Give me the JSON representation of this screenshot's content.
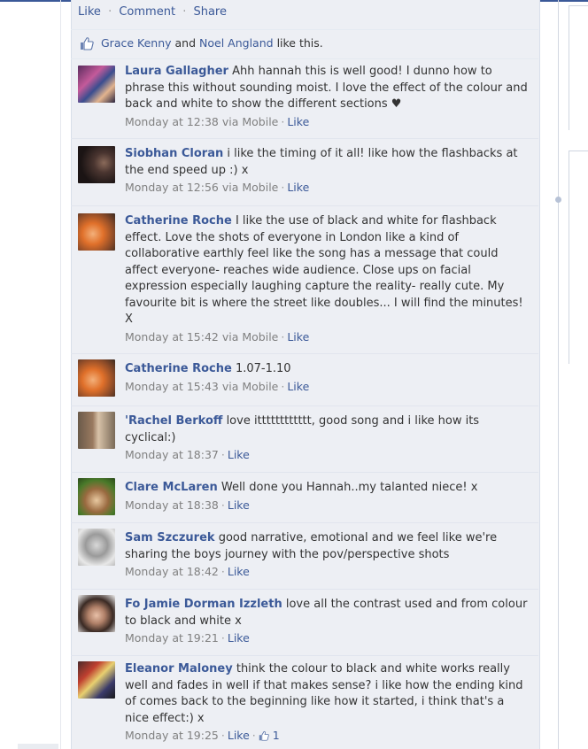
{
  "post_actions": {
    "like": "Like",
    "comment": "Comment",
    "share": "Share",
    "sep": "·"
  },
  "likes": {
    "user1": "Grace Kenny",
    "joiner": "and",
    "user2": "Noel Angland",
    "suffix": "like this."
  },
  "comments": [
    {
      "author": "Laura Gallagher",
      "text": "Ahh hannah this is well good! I dunno how to phrase this without sounding moist. I love the effect of the colour and back and white to show the different sections ♥",
      "time": "Monday at 12:38 via Mobile",
      "like": "Like"
    },
    {
      "author": "Siobhan Cloran",
      "text": "i like the timing of it all! like how the flashbacks at the end speed up :) x",
      "time": "Monday at 12:56 via Mobile",
      "like": "Like"
    },
    {
      "author": "Catherine Roche",
      "text": "I like the use of black and white for flashback effect. Love the shots of everyone in London like a kind of collaborative earthly feel like the song has a message that could affect everyone- reaches wide audience. Close ups on facial expression especially laughing capture the reality- really cute. My favourite bit is where the street like doubles... I will find the minutes! X",
      "time": "Monday at 15:42 via Mobile",
      "like": "Like"
    },
    {
      "author": "Catherine Roche",
      "text": "1.07-1.10",
      "time": "Monday at 15:43 via Mobile",
      "like": "Like"
    },
    {
      "author": "'Rachel Berkoff",
      "text": "love itttttttttttt, good song and i like how its cyclical:)",
      "time": "Monday at 18:37",
      "like": "Like"
    },
    {
      "author": "Clare McLaren",
      "text": "Well done you Hannah..my talanted niece! x",
      "time": "Monday at 18:38",
      "like": "Like"
    },
    {
      "author": "Sam Szczurek",
      "text": "good narrative, emotional and we feel like we're sharing the boys journey with the pov/perspective shots",
      "time": "Monday at 18:42",
      "like": "Like"
    },
    {
      "author": "Fo Jamie Dorman Izzleth",
      "text": "love all the contrast used and from colour to black and white x",
      "time": "Monday at 19:21",
      "like": "Like"
    },
    {
      "author": "Eleanor Maloney",
      "text": "think the colour to black and white works really well and fades in well if that makes sense? i like how the ending kind of comes back to the beginning like how it started, i think that's a nice effect:) x",
      "time": "Monday at 19:25",
      "like": "Like",
      "like_count": "1"
    }
  ],
  "colors": {
    "link": "#3b5998",
    "meta": "#808080",
    "feed_bg": "#edeff4"
  },
  "icons": [
    "thumbs-up-icon"
  ]
}
